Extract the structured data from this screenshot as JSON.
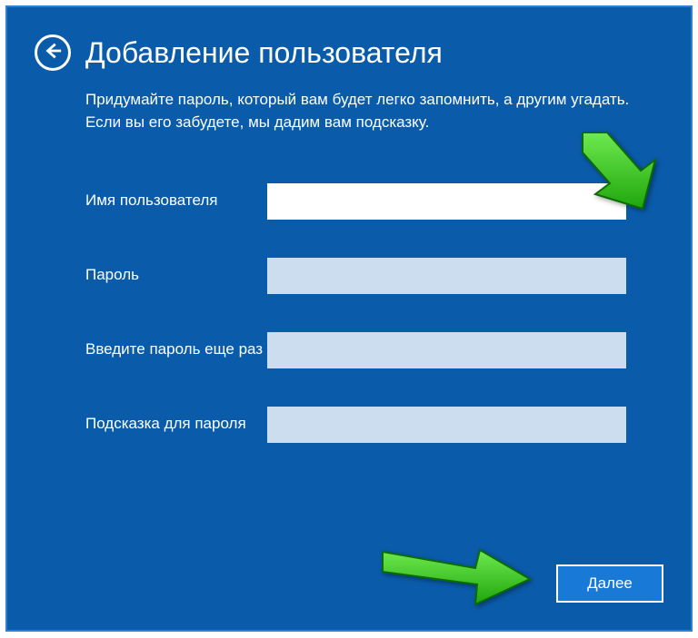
{
  "title": "Добавление пользователя",
  "description": "Придумайте пароль, который вам будет легко запомнить, а другим угадать. Если вы его забудете, мы дадим вам подсказку.",
  "fields": {
    "username": {
      "label": "Имя пользователя",
      "value": ""
    },
    "password": {
      "label": "Пароль",
      "value": ""
    },
    "confirm": {
      "label": "Введите пароль еще раз",
      "value": ""
    },
    "hint": {
      "label": "Подсказка для пароля",
      "value": ""
    }
  },
  "next_label": "Далее",
  "icons": {
    "back": "back-arrow-icon"
  },
  "colors": {
    "panel": "#0a5cab",
    "button": "#1979d6",
    "arrow": "#3ec423"
  }
}
